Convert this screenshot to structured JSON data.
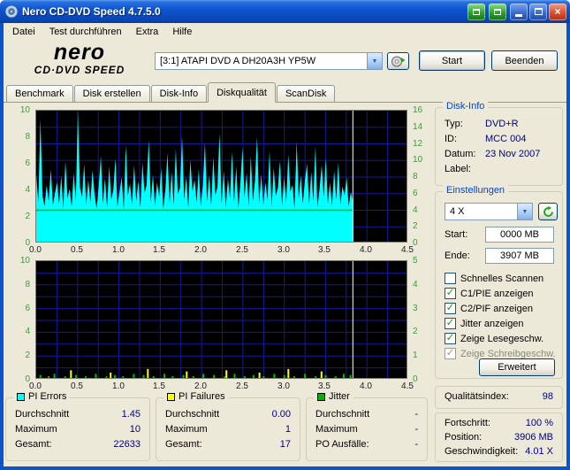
{
  "window": {
    "title": "Nero CD-DVD Speed 4.7.5.0"
  },
  "menu": {
    "items": [
      {
        "label": "Datei"
      },
      {
        "label": "Test durchführen"
      },
      {
        "label": "Extra"
      },
      {
        "label": "Hilfe"
      }
    ]
  },
  "toolbar": {
    "logo_line1": "nero",
    "logo_line2": "CD·DVD SPEED",
    "drive_value": "[3:1]   ATAPI DVD A  DH20A3H YP5W",
    "start_label": "Start",
    "quit_label": "Beenden"
  },
  "tabs": [
    {
      "label": "Benchmark",
      "active": false
    },
    {
      "label": "Disk erstellen",
      "active": false
    },
    {
      "label": "Disk-Info",
      "active": false
    },
    {
      "label": "Diskqualität",
      "active": true
    },
    {
      "label": "ScanDisk",
      "active": false
    }
  ],
  "disk_info": {
    "title": "Disk-Info",
    "rows": [
      {
        "label": "Typ:",
        "value": "DVD+R"
      },
      {
        "label": "ID:",
        "value": "MCC 004"
      },
      {
        "label": "Datum:",
        "value": "23 Nov 2007"
      },
      {
        "label": "Label:",
        "value": ""
      }
    ]
  },
  "settings": {
    "title": "Einstellungen",
    "speed_value": "4 X",
    "start_label": "Start:",
    "start_value": "0000 MB",
    "end_label": "Ende:",
    "end_value": "3907 MB",
    "checkboxes": [
      {
        "label": "Schnelles Scannen",
        "checked": false,
        "disabled": false
      },
      {
        "label": "C1/PIE anzeigen",
        "checked": true,
        "disabled": false
      },
      {
        "label": "C2/PIF anzeigen",
        "checked": true,
        "disabled": false
      },
      {
        "label": "Jitter anzeigen",
        "checked": true,
        "disabled": false
      },
      {
        "label": "Zeige Lesegeschw.",
        "checked": true,
        "disabled": false
      },
      {
        "label": "Zeige Schreibgeschw.",
        "checked": true,
        "disabled": true
      }
    ],
    "advanced_label": "Erweitert"
  },
  "quality": {
    "label": "Qualitätsindex:",
    "value": "98"
  },
  "progress": {
    "rows": [
      {
        "label": "Fortschritt:",
        "value": "100 %"
      },
      {
        "label": "Position:",
        "value": "3906 MB"
      },
      {
        "label": "Geschwindigkeit:",
        "value": "4.01 X"
      }
    ]
  },
  "stats": [
    {
      "title": "PI Errors",
      "color": "#00FFFF",
      "rows": [
        {
          "label": "Durchschnitt",
          "value": "1.45"
        },
        {
          "label": "Maximum",
          "value": "10"
        },
        {
          "label": "Gesamt:",
          "value": "22633"
        }
      ]
    },
    {
      "title": "PI Failures",
      "color": "#FFFF00",
      "rows": [
        {
          "label": "Durchschnitt",
          "value": "0.00"
        },
        {
          "label": "Maximum",
          "value": "1"
        },
        {
          "label": "Gesamt:",
          "value": "17"
        }
      ]
    },
    {
      "title": "Jitter",
      "color": "#00B400",
      "rows": [
        {
          "label": "Durchschnitt",
          "value": "-"
        },
        {
          "label": "Maximum",
          "value": "-"
        },
        {
          "label": "PO Ausfälle:",
          "value": "-"
        }
      ]
    }
  ],
  "colors": {
    "value_text": "#000080",
    "group_title": "#0046D5",
    "axis_labels": "#3C9B3C",
    "grid": "#17179B",
    "cursor": "#FFFFFF",
    "pi_errors": "#00FFFF",
    "pi_failures": "#FFFF00",
    "jitter": "#00B400",
    "read_speed_line": "#00B400"
  },
  "chart_data": {
    "type": "area",
    "grid_color": "#17179B",
    "cursor_color": "#FFFFFF",
    "charts": [
      {
        "title": "PI Errors (oben)",
        "x_max": 4.5,
        "x_ticks": [
          "0.0",
          "0.5",
          "1.0",
          "1.5",
          "2.0",
          "2.5",
          "3.0",
          "3.5",
          "4.0",
          "4.5"
        ],
        "y_left_ticks": [
          10,
          8,
          6,
          4,
          2,
          0
        ],
        "y_left_max": 10,
        "y_right_ticks": [
          16,
          14,
          12,
          10,
          8,
          6,
          4,
          2,
          0
        ],
        "y_right_max": 16,
        "data_end_x": 3.83,
        "series": [
          {
            "name": "PI Errors",
            "color": "#00FFFF",
            "y_scale": "left",
            "values": [
              5.2,
              3.1,
              9.4,
              3.6,
              2.8,
              4.4,
              3.2,
              5.6,
              2.9,
              3.8,
              4.6,
              3.0,
              5.1,
              2.6,
              6.2,
              3.4,
              4.1,
              2.8,
              5.3,
              3.2,
              10.0,
              4.2,
              3.5,
              6.0,
              2.9,
              4.8,
              3.1,
              5.5,
              3.7,
              2.6,
              4.3,
              6.6,
              3.0,
              4.9,
              2.7,
              5.8,
              3.3,
              4.0,
              6.4,
              2.8,
              3.9,
              5.0,
              2.5,
              7.4,
              3.6,
              4.5,
              2.9,
              5.9,
              3.2,
              4.7,
              2.7,
              6.1,
              3.8,
              4.4,
              7.8,
              3.1,
              5.2,
              2.8,
              4.6,
              3.5,
              5.7,
              2.6,
              4.1,
              6.8,
              3.0,
              5.4,
              2.9,
              7.1,
              3.7,
              4.2,
              8.1,
              3.3,
              5.0,
              2.7,
              6.3,
              3.9,
              4.8,
              3.1,
              5.6,
              2.8,
              4.4,
              7.6,
              3.2,
              5.1,
              2.9,
              6.5,
              3.6,
              4.3,
              8.3,
              3.0,
              5.5,
              2.7,
              4.9,
              3.4,
              6.9,
              3.1,
              5.8,
              2.6,
              4.5,
              7.2,
              3.5,
              5.3,
              2.8,
              6.6,
              3.2,
              4.7,
              8.0,
              3.0,
              5.2,
              2.9,
              4.6,
              3.3,
              7.0,
              2.7,
              5.7,
              3.6,
              4.2,
              6.2,
              2.8,
              5.0,
              3.1,
              6.7,
              3.9,
              4.4,
              2.6,
              7.7,
              3.4,
              5.1,
              3.0,
              4.8,
              6.0,
              2.9,
              5.4,
              3.2,
              7.3,
              2.7,
              4.1,
              5.9,
              3.5,
              6.4,
              3.0,
              4.6,
              2.8,
              5.5,
              3.3,
              6.1,
              2.9,
              4.3,
              3.6,
              5.0,
              2.8,
              3.9,
              3.1
            ]
          },
          {
            "name": "Lesegeschwindigkeit 4X",
            "color": "#00B400",
            "y_scale": "right",
            "constant_value": 4
          }
        ]
      },
      {
        "title": "PI Failures / Jitter (unten)",
        "x_max": 4.5,
        "x_ticks": [
          "0.0",
          "0.5",
          "1.0",
          "1.5",
          "2.0",
          "2.5",
          "3.0",
          "3.5",
          "4.0",
          "4.5"
        ],
        "y_left_ticks": [
          10,
          8,
          6,
          4,
          2,
          0
        ],
        "y_left_max": 10,
        "y_right_ticks": [
          5,
          4,
          3,
          2,
          1,
          0
        ],
        "y_right_max": 5,
        "data_end_x": 3.83,
        "series": [
          {
            "name": "Jitter",
            "color": "#00B400",
            "y_scale": "left",
            "points": [
              [
                0.05,
                0.4
              ],
              [
                0.15,
                0.3
              ],
              [
                0.22,
                0.5
              ],
              [
                0.35,
                0.3
              ],
              [
                0.48,
                0.4
              ],
              [
                0.6,
                0.3
              ],
              [
                0.72,
                0.5
              ],
              [
                0.85,
                0.3
              ],
              [
                0.95,
                0.4
              ],
              [
                1.05,
                0.3
              ],
              [
                1.18,
                0.5
              ],
              [
                1.3,
                0.4
              ],
              [
                1.42,
                0.3
              ],
              [
                1.55,
                0.5
              ],
              [
                1.65,
                0.3
              ],
              [
                1.78,
                0.4
              ],
              [
                1.9,
                0.3
              ],
              [
                2.02,
                0.5
              ],
              [
                2.15,
                0.4
              ],
              [
                2.28,
                0.3
              ],
              [
                2.4,
                0.5
              ],
              [
                2.52,
                0.3
              ],
              [
                2.63,
                0.4
              ],
              [
                2.75,
                0.3
              ],
              [
                2.88,
                0.5
              ],
              [
                3.0,
                0.4
              ],
              [
                3.12,
                0.3
              ],
              [
                3.25,
                0.5
              ],
              [
                3.38,
                0.3
              ],
              [
                3.5,
                0.4
              ],
              [
                3.62,
                0.3
              ],
              [
                3.72,
                0.5
              ],
              [
                3.8,
                0.4
              ]
            ]
          },
          {
            "name": "PI Failures",
            "color": "#FFFF00",
            "y_scale": "left",
            "points": [
              [
                0.42,
                0.8
              ],
              [
                0.9,
                0.6
              ],
              [
                1.35,
                0.9
              ],
              [
                1.82,
                0.7
              ],
              [
                2.3,
                0.8
              ],
              [
                2.7,
                0.6
              ],
              [
                3.05,
                0.9
              ],
              [
                3.45,
                0.7
              ]
            ]
          }
        ]
      }
    ]
  }
}
